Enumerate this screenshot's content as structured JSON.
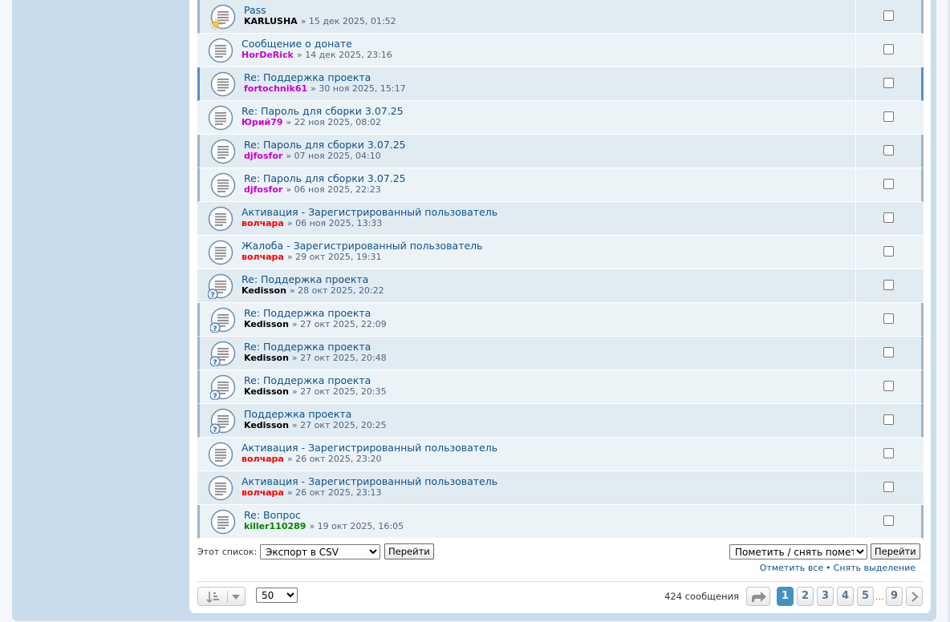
{
  "colors": {
    "title": "#105289",
    "meta": "#536482",
    "user_black": "#000000",
    "user_magenta": "#cc00cc",
    "user_red": "#ff0000",
    "user_green": "#008000",
    "accent": "#4692bf"
  },
  "messages": [
    {
      "title": "Pass",
      "author": "KARLUSHA",
      "date": "» 15 дек 2025, 01:52",
      "color": "#000000",
      "icon": "message-unread-icon",
      "badge": "sun-icon"
    },
    {
      "title": "Сообщение о донате",
      "author": "HorDeRick",
      "date": "» 14 дек 2025, 23:16",
      "color": "#cc00cc",
      "icon": "message-icon",
      "badge": ""
    },
    {
      "title": "Re: Поддержка проекта",
      "author": "fortochnik61",
      "date": "» 30 ноя 2025, 15:17",
      "color": "#cc00cc",
      "icon": "message-icon",
      "badge": ""
    },
    {
      "title": "Re: Пароль для сборки 3.07.25",
      "author": "Юрий79",
      "date": "» 22 ноя 2025, 08:02",
      "color": "#cc00cc",
      "icon": "message-icon",
      "badge": ""
    },
    {
      "title": "Re: Пароль для сборки 3.07.25",
      "author": "djfosfor",
      "date": "» 07 ноя 2025, 04:10",
      "color": "#cc00cc",
      "icon": "message-icon",
      "badge": ""
    },
    {
      "title": "Re: Пароль для сборки 3.07.25",
      "author": "djfosfor",
      "date": "» 06 ноя 2025, 22:23",
      "color": "#cc00cc",
      "icon": "message-icon",
      "badge": ""
    },
    {
      "title": "Активация - Зарегистрированный пользователь",
      "author": "волчара",
      "date": "» 06 ноя 2025, 13:33",
      "color": "#ff0000",
      "icon": "message-icon",
      "badge": ""
    },
    {
      "title": "Жалоба - Зарегистрированный пользователь",
      "author": "волчара",
      "date": "» 29 окт 2025, 19:31",
      "color": "#ff0000",
      "icon": "message-icon",
      "badge": ""
    },
    {
      "title": "Re: Поддержка проекта",
      "author": "Kedisson",
      "date": "» 28 окт 2025, 20:22",
      "color": "#000000",
      "icon": "message-icon",
      "badge": "question-icon"
    },
    {
      "title": "Re: Поддержка проекта",
      "author": "Kedisson",
      "date": "» 27 окт 2025, 22:09",
      "color": "#000000",
      "icon": "message-icon",
      "badge": "question-icon"
    },
    {
      "title": "Re: Поддержка проекта",
      "author": "Kedisson",
      "date": "» 27 окт 2025, 20:48",
      "color": "#000000",
      "icon": "message-icon",
      "badge": "question-icon"
    },
    {
      "title": "Re: Поддержка проекта",
      "author": "Kedisson",
      "date": "» 27 окт 2025, 20:35",
      "color": "#000000",
      "icon": "message-icon",
      "badge": "question-icon"
    },
    {
      "title": "Поддержка проекта",
      "author": "Kedisson",
      "date": "» 27 окт 2025, 20:25",
      "color": "#000000",
      "icon": "message-icon",
      "badge": "question-icon"
    },
    {
      "title": "Активация - Зарегистрированный пользователь",
      "author": "волчара",
      "date": "» 26 окт 2025, 23:20",
      "color": "#ff0000",
      "icon": "message-icon",
      "badge": ""
    },
    {
      "title": "Активация - Зарегистрированный пользователь",
      "author": "волчара",
      "date": "» 26 окт 2025, 23:13",
      "color": "#ff0000",
      "icon": "message-icon",
      "badge": ""
    },
    {
      "title": "Re: Вопрос",
      "author": "killer110289",
      "date": "» 19 окт 2025, 16:05",
      "color": "#008000",
      "icon": "message-icon",
      "badge": ""
    }
  ],
  "actions": {
    "list_label": "Этот список:",
    "export_selected": "Экспорт в CSV",
    "go_label": "Перейти",
    "mark_selected": "Пометить / снять пометку",
    "go_label2": "Перейти",
    "mark_all": "Отметить все",
    "separator": "•",
    "unmark_all": "Снять выделение"
  },
  "pagination": {
    "per_page": "50",
    "count": "424 сообщения",
    "pages": [
      "1",
      "2",
      "3",
      "4",
      "5"
    ],
    "ellipsis": "…",
    "last": "9",
    "current": "1"
  }
}
